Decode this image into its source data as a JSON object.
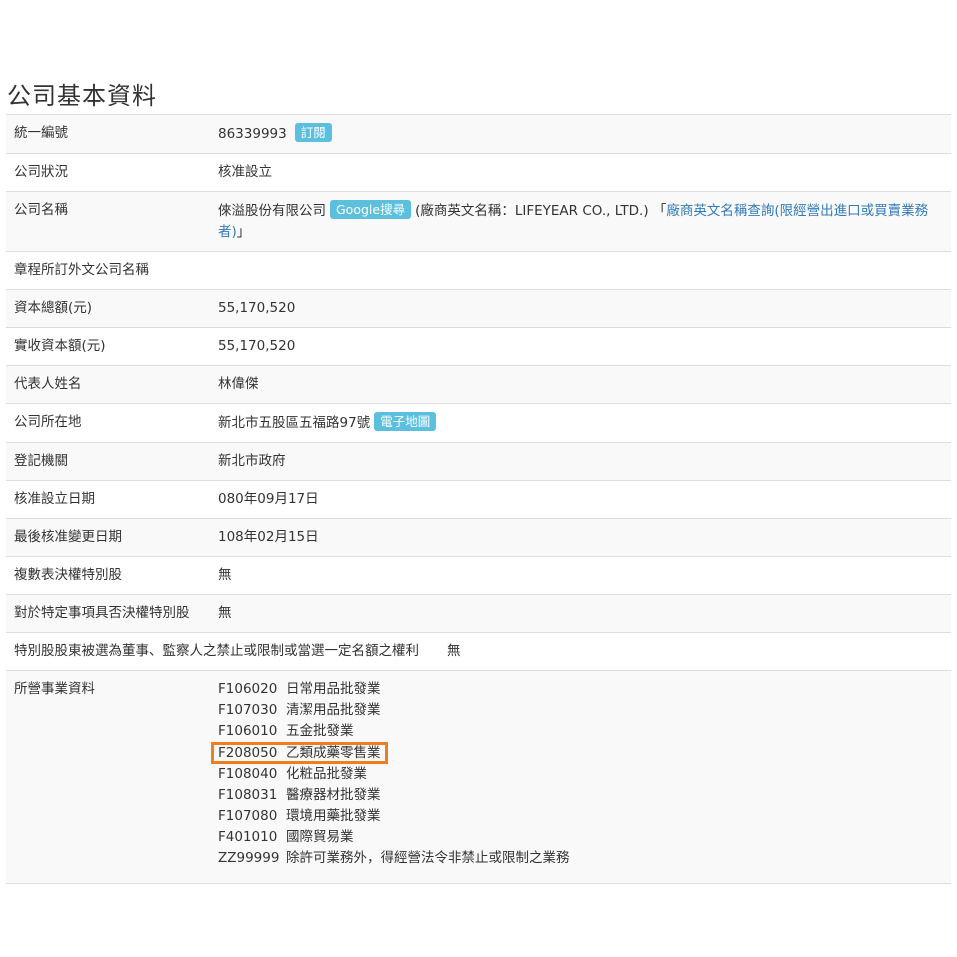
{
  "page_title": "公司基本資料",
  "accent_colors": {
    "badge": "#5bc0de",
    "link": "#337ab7",
    "highlight": "#f07d1e"
  },
  "rows": {
    "uniform_number": {
      "label": "統一編號",
      "value": "86339993",
      "badge": "訂閱"
    },
    "status": {
      "label": "公司狀況",
      "value": "核准設立"
    },
    "company_name": {
      "label": "公司名稱",
      "value": "倈溢股份有限公司",
      "badge": "Google搜尋",
      "english_name": "(廠商英文名稱：LIFEYEAR CO., LTD.)",
      "link_open": "「",
      "link_text": "廠商英文名稱查詢(限經營出進口或買賣業務者)",
      "link_close": "」"
    },
    "foreign_name": {
      "label": "章程所訂外文公司名稱",
      "value": ""
    },
    "capital_total": {
      "label": "資本總額(元)",
      "value": "55,170,520"
    },
    "capital_paid": {
      "label": "實收資本額(元)",
      "value": "55,170,520"
    },
    "representative": {
      "label": "代表人姓名",
      "value": "林偉傑"
    },
    "address": {
      "label": "公司所在地",
      "value": "新北市五股區五福路97號",
      "badge": "電子地圖"
    },
    "registry": {
      "label": "登記機關",
      "value": "新北市政府"
    },
    "approval_date": {
      "label": "核准設立日期",
      "value": "080年09月17日"
    },
    "last_change_date": {
      "label": "最後核准變更日期",
      "value": "108年02月15日"
    },
    "multi_vote": {
      "label": "複數表決權特別股",
      "value": "無"
    },
    "veto": {
      "label": "對於特定事項具否決權特別股",
      "value": "無"
    },
    "director_restrict": {
      "label": "特別股股東被選為董事、監察人之禁止或限制或當選一定名額之權利",
      "value": "無"
    },
    "business": {
      "label": "所營事業資料",
      "items": [
        {
          "code": "F106020",
          "name": "日常用品批發業"
        },
        {
          "code": "F107030",
          "name": "清潔用品批發業"
        },
        {
          "code": "F106010",
          "name": "五金批發業"
        },
        {
          "code": "F208050",
          "name": "乙類成藥零售業"
        },
        {
          "code": "F108040",
          "name": "化粧品批發業"
        },
        {
          "code": "F108031",
          "name": "醫療器材批發業"
        },
        {
          "code": "F107080",
          "name": "環境用藥批發業"
        },
        {
          "code": "F401010",
          "name": "國際貿易業"
        },
        {
          "code": "ZZ99999",
          "name": "除許可業務外，得經營法令非禁止或限制之業務"
        }
      ]
    }
  }
}
